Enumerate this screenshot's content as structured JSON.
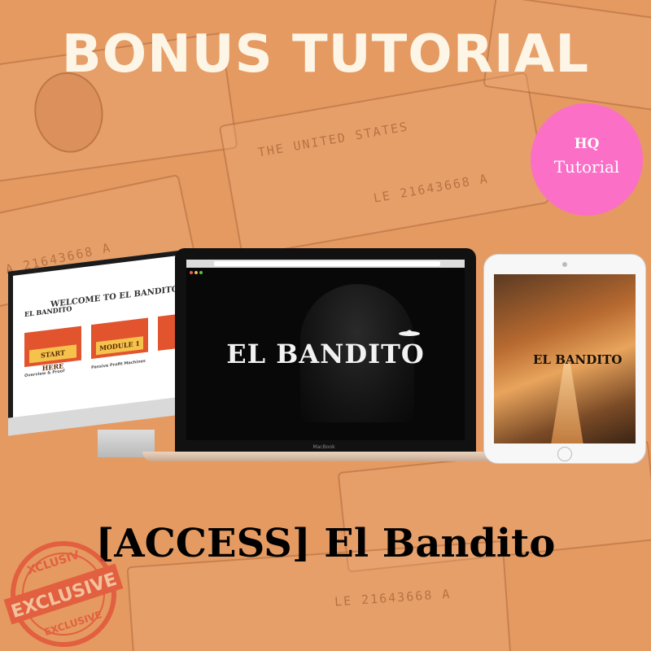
{
  "headline": "BONUS TUTORIAL",
  "badge": {
    "line1": "HQ",
    "line2": "Tutorial",
    "color": "#fb6fc7"
  },
  "devices": {
    "imac": {
      "welcome": "WELCOME TO EL BANDITO",
      "logo": "EL BANDITO",
      "card1": "START HERE",
      "card2": "MODULE 1",
      "text1": "Overview & Proof",
      "text2": "Passive Profit Machines"
    },
    "macbook": {
      "brand": "EL BANDITO",
      "label": "MacBook"
    },
    "ipad": {
      "brand": "EL BANDITO"
    }
  },
  "title": "[ACCESS] El Bandito",
  "stamp": {
    "top": "XCLUSIV",
    "middle": "EXCLUSIVE",
    "bottom": "EXCLUSIVE",
    "color": "#e2573a"
  },
  "background_color": "#e59a62"
}
